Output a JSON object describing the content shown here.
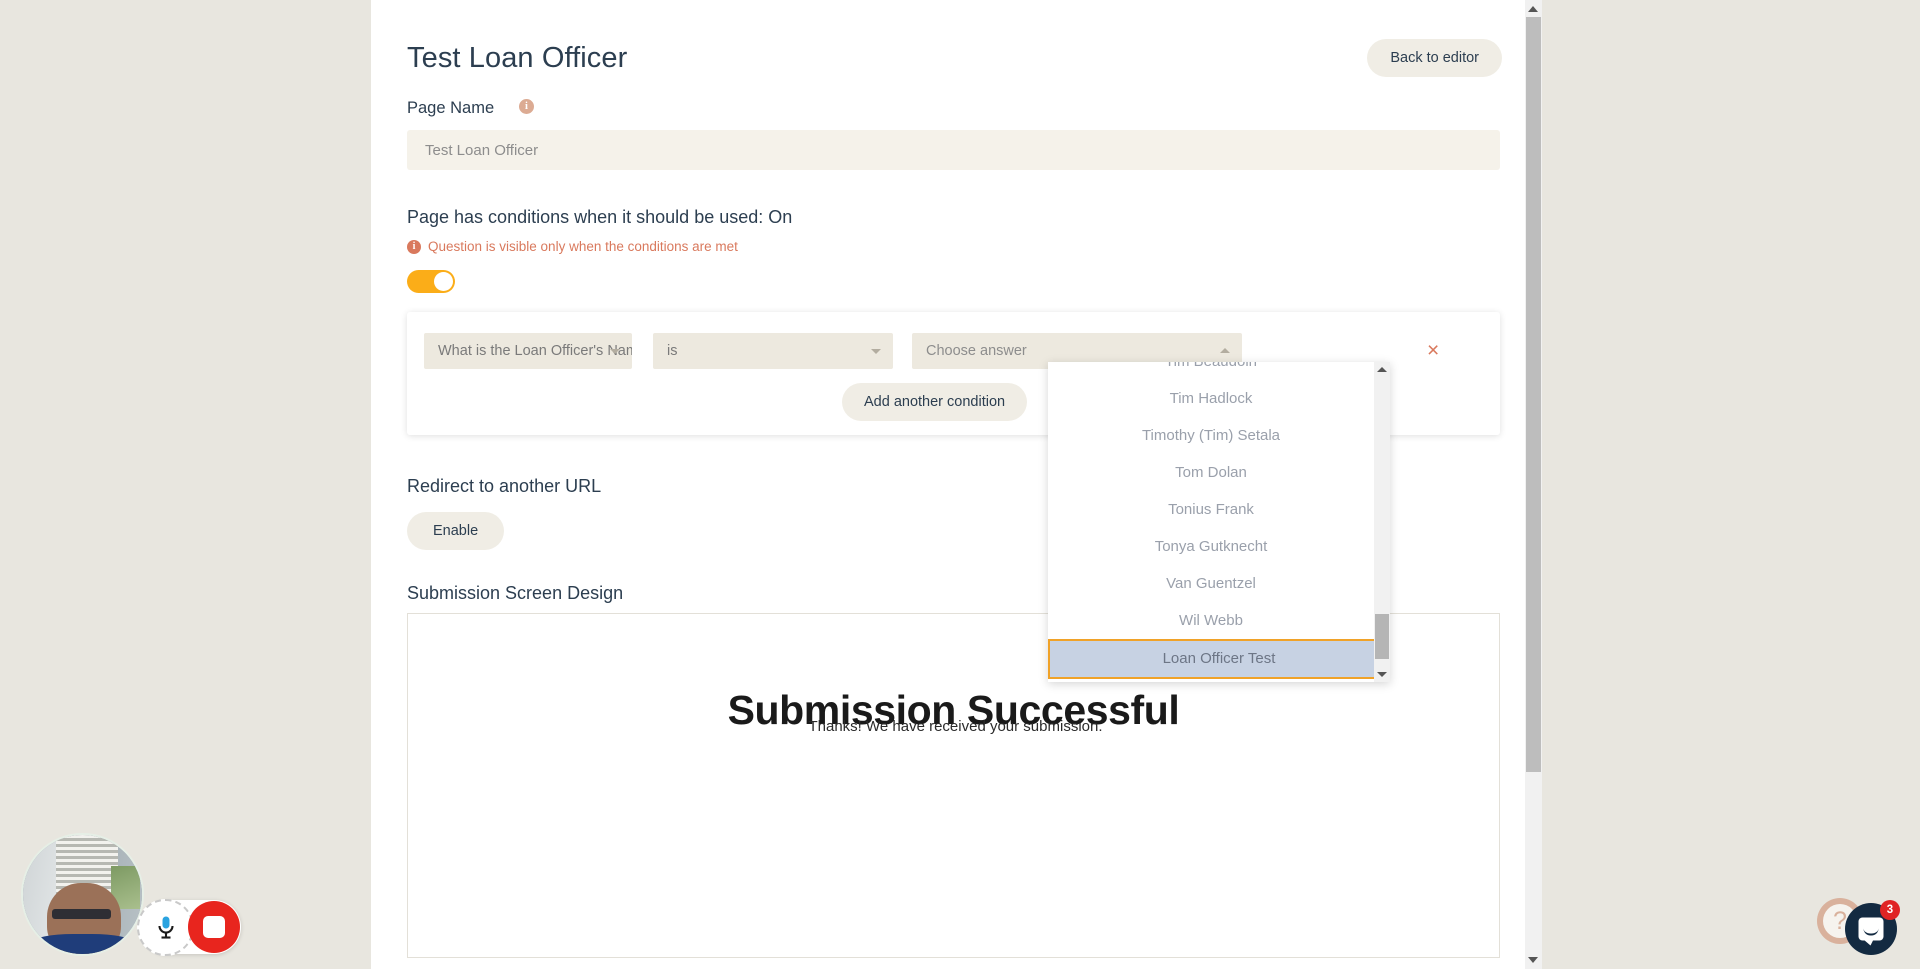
{
  "header": {
    "title": "Test Loan Officer",
    "back_button": "Back to editor"
  },
  "page_name": {
    "label": "Page Name",
    "info_icon": "info-icon",
    "value": "Test Loan Officer",
    "placeholder": "Test Loan Officer"
  },
  "conditions": {
    "heading": "Page has conditions when it should be used: On",
    "note": "Question is visible only when the conditions are met",
    "note_icon": "info-icon",
    "toggle_state": "on",
    "toggle_color": "#fbad18",
    "row": {
      "question_select": "What is the Loan Officer's Nam",
      "operator_select": "is",
      "answer_select": "Choose answer",
      "remove_label": "×"
    },
    "add_button": "Add another condition"
  },
  "answer_dropdown": {
    "open": true,
    "items": [
      "Tim Beaudoin",
      "Tim Hadlock",
      "Timothy (Tim) Setala",
      "Tom Dolan",
      "Tonius Frank",
      "Tonya Gutknecht",
      "Van Guentzel",
      "Wil Webb",
      "Loan Officer Test"
    ],
    "highlighted": "Loan Officer Test",
    "highlight_border_color": "#f0a228",
    "highlight_bg_color": "#c7d2e3"
  },
  "redirect": {
    "heading": "Redirect to another URL",
    "enable_button": "Enable"
  },
  "submission": {
    "heading": "Submission Screen Design",
    "title": "Submission Successful",
    "subtitle": "Thanks! We have received your submission."
  },
  "recorder": {
    "camera_label": "webcam-preview",
    "mic_label": "microphone-icon",
    "stop_label": "stop-recording-icon"
  },
  "widgets": {
    "help_glyph": "?",
    "chat_badge": "3"
  }
}
